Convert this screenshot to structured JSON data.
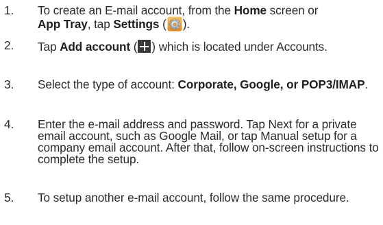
{
  "steps": [
    {
      "number": "1.",
      "parts": [
        "To create an E-mail account, from the ",
        "Home",
        " screen or ",
        "App Tray",
        ", tap ",
        "Settings",
        " (",
        ")."
      ],
      "icon": "settings-gear-icon"
    },
    {
      "number": "2.",
      "parts": [
        "Tap ",
        "Add account",
        " (",
        ") which is located under Accounts."
      ],
      "icon": "add-plus-icon"
    },
    {
      "number": "3.",
      "parts": [
        "Select the type of account: ",
        "Corporate, Google, or POP3/IMAP",
        "."
      ]
    },
    {
      "number": "4.",
      "text": "Enter the e-mail address and password. Tap Next for a private email account, such as Google Mail, or tap Manual setup for a company email account. After that, follow on-screen instructions to complete the setup."
    },
    {
      "number": "5.",
      "text": "To setup another e-mail account, follow the same procedure."
    }
  ]
}
